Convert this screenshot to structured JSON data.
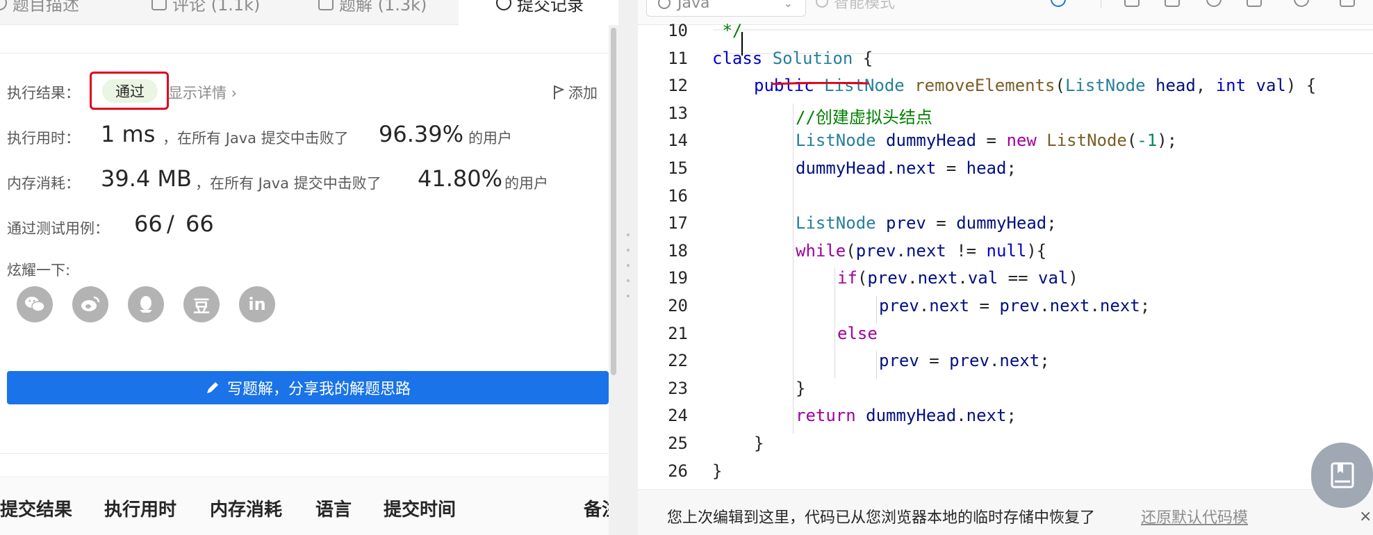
{
  "left_tabs": [
    {
      "label": "题目描述"
    },
    {
      "label": "评论 (1.1k)"
    },
    {
      "label": "题解 (1.3k)"
    },
    {
      "label": "提交记录"
    }
  ],
  "result": {
    "label": "执行结果：",
    "status": "通过",
    "show_detail": "显示详情 ›",
    "add_note": "添加"
  },
  "runtime": {
    "label": "执行用时：",
    "value": "1 ms",
    "beat_text": "，在所有 Java 提交中击败了",
    "percent": "96.39%",
    "suffix": "的用户"
  },
  "memory": {
    "label": "内存消耗：",
    "value": "39.4 MB",
    "beat_text": "，在所有 Java 提交中击败了",
    "percent": "41.80%",
    "suffix": "的用户"
  },
  "tests": {
    "label": "通过测试用例：",
    "passed": "66",
    "separator": "/",
    "total": "66"
  },
  "share": {
    "label": "炫耀一下:",
    "icons": [
      "wechat-icon",
      "weibo-icon",
      "qq-icon",
      "douban-icon",
      "linkedin-icon"
    ],
    "douban_glyph": "豆",
    "linkedin_glyph": "in"
  },
  "write_button": {
    "label": "写题解，分享我的解题思路"
  },
  "table_headers": [
    "提交结果",
    "执行用时",
    "内存消耗",
    "语言",
    "提交时间",
    "备注"
  ],
  "editor": {
    "language": "Java",
    "mode": "智能模式",
    "lines": [
      {
        "n": "10",
        "indent": 0,
        "tokens": [
          [
            "k-cmt",
            " */"
          ]
        ]
      },
      {
        "n": "11",
        "indent": 0,
        "tokens": [
          [
            "k-kw",
            "class"
          ],
          [
            "",
            " "
          ],
          [
            "k-type",
            "Solution"
          ],
          [
            "",
            " {"
          ]
        ]
      },
      {
        "n": "12",
        "indent": 1,
        "tokens": [
          [
            "k-kw",
            "public"
          ],
          [
            "",
            " "
          ],
          [
            "k-type",
            "ListNode"
          ],
          [
            "",
            " "
          ],
          [
            "k-fn",
            "removeElements"
          ],
          [
            "",
            "("
          ],
          [
            "k-type",
            "ListNode"
          ],
          [
            "",
            " "
          ],
          [
            "k-var",
            "head"
          ],
          [
            "",
            ", "
          ],
          [
            "k-kw",
            "int"
          ],
          [
            "",
            " "
          ],
          [
            "k-var",
            "val"
          ],
          [
            "",
            ") {"
          ]
        ]
      },
      {
        "n": "13",
        "indent": 2,
        "tokens": [
          [
            "k-cmt",
            "//创建虚拟头结点"
          ]
        ]
      },
      {
        "n": "14",
        "indent": 2,
        "tokens": [
          [
            "k-type",
            "ListNode"
          ],
          [
            "",
            " "
          ],
          [
            "k-var",
            "dummyHead"
          ],
          [
            "",
            " = "
          ],
          [
            "k-kw2",
            "new"
          ],
          [
            "",
            " "
          ],
          [
            "k-fn",
            "ListNode"
          ],
          [
            "",
            "("
          ],
          [
            "k-num",
            "-1"
          ],
          [
            "",
            ");"
          ]
        ]
      },
      {
        "n": "15",
        "indent": 2,
        "tokens": [
          [
            "k-var",
            "dummyHead"
          ],
          [
            "",
            "."
          ],
          [
            "k-var",
            "next"
          ],
          [
            "",
            " = "
          ],
          [
            "k-var",
            "head"
          ],
          [
            "",
            ";"
          ]
        ]
      },
      {
        "n": "16",
        "indent": 2,
        "tokens": []
      },
      {
        "n": "17",
        "indent": 2,
        "tokens": [
          [
            "k-type",
            "ListNode"
          ],
          [
            "",
            " "
          ],
          [
            "k-var",
            "prev"
          ],
          [
            "",
            " = "
          ],
          [
            "k-var",
            "dummyHead"
          ],
          [
            "",
            ";"
          ]
        ]
      },
      {
        "n": "18",
        "indent": 2,
        "tokens": [
          [
            "k-kw2",
            "while"
          ],
          [
            "",
            "("
          ],
          [
            "k-var",
            "prev"
          ],
          [
            "",
            "."
          ],
          [
            "k-var",
            "next"
          ],
          [
            "",
            " != "
          ],
          [
            "k-kw",
            "null"
          ],
          [
            "",
            "){"
          ]
        ]
      },
      {
        "n": "19",
        "indent": 3,
        "tokens": [
          [
            "k-kw2",
            "if"
          ],
          [
            "",
            "("
          ],
          [
            "k-var",
            "prev"
          ],
          [
            "",
            "."
          ],
          [
            "k-var",
            "next"
          ],
          [
            "",
            "."
          ],
          [
            "k-var",
            "val"
          ],
          [
            "",
            " == "
          ],
          [
            "k-var",
            "val"
          ],
          [
            "",
            ")"
          ]
        ]
      },
      {
        "n": "20",
        "indent": 4,
        "tokens": [
          [
            "k-var",
            "prev"
          ],
          [
            "",
            "."
          ],
          [
            "k-var",
            "next"
          ],
          [
            "",
            " = "
          ],
          [
            "k-var",
            "prev"
          ],
          [
            "",
            "."
          ],
          [
            "k-var",
            "next"
          ],
          [
            "",
            "."
          ],
          [
            "k-var",
            "next"
          ],
          [
            "",
            ";"
          ]
        ]
      },
      {
        "n": "21",
        "indent": 3,
        "tokens": [
          [
            "k-kw2",
            "else"
          ]
        ]
      },
      {
        "n": "22",
        "indent": 4,
        "tokens": [
          [
            "k-var",
            "prev"
          ],
          [
            "",
            " = "
          ],
          [
            "k-var",
            "prev"
          ],
          [
            "",
            "."
          ],
          [
            "k-var",
            "next"
          ],
          [
            "",
            ";"
          ]
        ]
      },
      {
        "n": "23",
        "indent": 2,
        "tokens": [
          [
            "",
            "}"
          ]
        ]
      },
      {
        "n": "24",
        "indent": 2,
        "tokens": [
          [
            "k-kw2",
            "return"
          ],
          [
            "",
            " "
          ],
          [
            "k-var",
            "dummyHead"
          ],
          [
            "",
            "."
          ],
          [
            "k-var",
            "next"
          ],
          [
            "",
            ";"
          ]
        ]
      },
      {
        "n": "25",
        "indent": 1,
        "tokens": [
          [
            "",
            "}"
          ]
        ]
      },
      {
        "n": "26",
        "indent": 0,
        "tokens": [
          [
            "",
            "}"
          ]
        ]
      }
    ]
  },
  "restore": {
    "message": "您上次编辑到这里，代码已从您浏览器本地的临时存储中恢复了",
    "link": "还原默认代码模",
    "close": "×"
  },
  "colors": {
    "accent": "#1a73e8",
    "highlight_box": "#e0001b",
    "pass_tag_bg": "#eaf5e4"
  }
}
